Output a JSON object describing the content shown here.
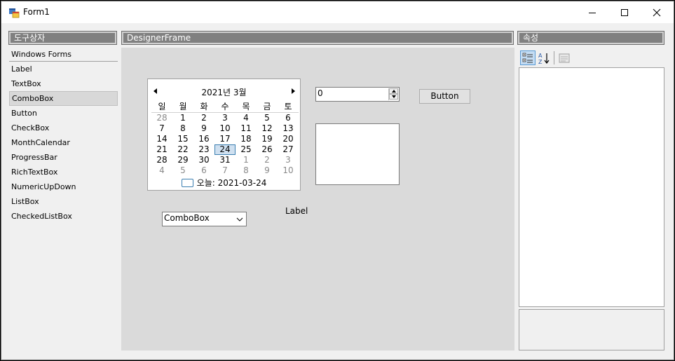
{
  "window": {
    "title": "Form1"
  },
  "toolbox": {
    "header": "도구상자",
    "group": "Windows Forms",
    "items": [
      "Label",
      "TextBox",
      "ComboBox",
      "Button",
      "CheckBox",
      "MonthCalendar",
      "ProgressBar",
      "RichTextBox",
      "NumericUpDown",
      "ListBox",
      "CheckedListBox"
    ],
    "selected_index": 2
  },
  "designer": {
    "header": "DesignerFrame",
    "calendar": {
      "month_title": "2021년 3월",
      "weekdays": [
        "일",
        "월",
        "화",
        "수",
        "목",
        "금",
        "토"
      ],
      "weeks": [
        [
          "28",
          "1",
          "2",
          "3",
          "4",
          "5",
          "6"
        ],
        [
          "7",
          "8",
          "9",
          "10",
          "11",
          "12",
          "13"
        ],
        [
          "14",
          "15",
          "16",
          "17",
          "18",
          "19",
          "20"
        ],
        [
          "21",
          "22",
          "23",
          "24",
          "25",
          "26",
          "27"
        ],
        [
          "28",
          "29",
          "30",
          "31",
          "1",
          "2",
          "3"
        ],
        [
          "4",
          "5",
          "6",
          "7",
          "8",
          "9",
          "10"
        ]
      ],
      "selected_day": "24",
      "today_text": "오늘: 2021-03-24"
    },
    "numeric_value": "0",
    "button_label": "Button",
    "combobox_value": "ComboBox",
    "label_text": "Label"
  },
  "properties": {
    "header": "속성"
  }
}
